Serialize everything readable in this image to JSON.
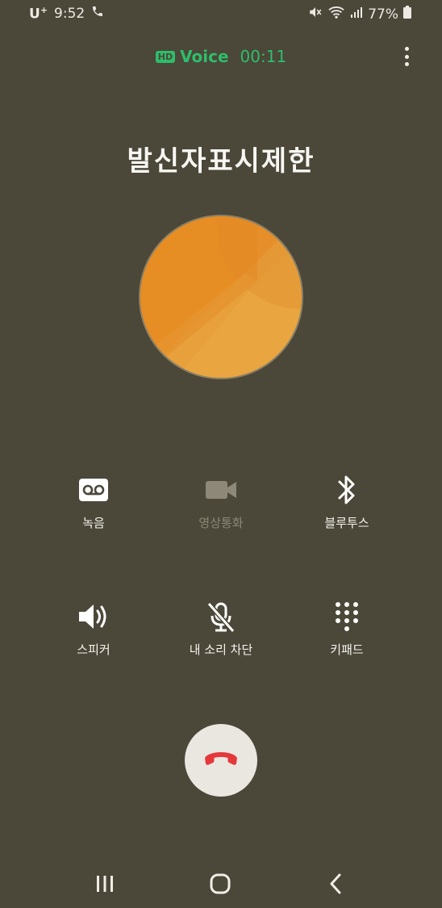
{
  "status_bar": {
    "carrier": "U",
    "carrier_sup": "+",
    "time": "9:52",
    "battery": "77%"
  },
  "call_header": {
    "hd_badge": "HD",
    "call_type": "Voice",
    "timer": "00:11"
  },
  "caller": {
    "name": "발신자표시제한"
  },
  "controls": {
    "record": "녹음",
    "video_call": "영상통화",
    "bluetooth": "블루투스",
    "speaker": "스피커",
    "mute": "내 소리 차단",
    "keypad": "키패드"
  },
  "colors": {
    "background": "#4b4739",
    "accent_green": "#2ebd6a",
    "end_call_red": "#e5383b",
    "avatar_orange": "#e8a03c"
  },
  "icons": [
    "phone-icon",
    "mute-sound-icon",
    "wifi-icon",
    "signal-icon",
    "battery-icon",
    "more-icon",
    "voicemail-icon",
    "video-camera-icon",
    "bluetooth-icon",
    "speaker-icon",
    "mic-off-icon",
    "dialpad-icon",
    "end-call-icon",
    "recents-icon",
    "home-icon",
    "back-icon"
  ]
}
